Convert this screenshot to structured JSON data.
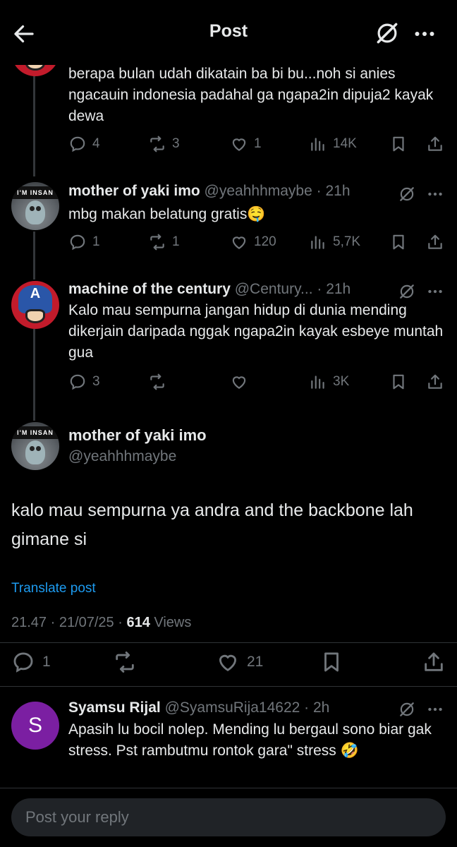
{
  "header": {
    "title": "Post"
  },
  "tweets": [
    {
      "body_partial": "berapa bulan udah dikatain ba bi bu...noh si anies ngacauin indonesia padahal ga ngapa2in dipuja2 kayak dewa",
      "replies": "4",
      "retweets": "3",
      "likes": "1",
      "views": "14K"
    },
    {
      "name": "mother of yaki imo",
      "handle": "@yeahhhmaybe",
      "time": "21h",
      "avatar_text": "I'M INSAN",
      "body": "mbg makan belatung gratis🤤",
      "replies": "1",
      "retweets": "1",
      "likes": "120",
      "views": "5,7K"
    },
    {
      "name": "machine of the century",
      "handle": "@Century...",
      "time": "21h",
      "avatar_text": "A",
      "body": "Kalo mau sempurna jangan hidup di dunia mending dikerjain daripada nggak ngapa2in kayak esbeye muntah gua",
      "replies": "3",
      "retweets": "",
      "likes": "",
      "views": "3K"
    }
  ],
  "focus": {
    "name": "mother of yaki imo",
    "handle": "@yeahhhmaybe",
    "avatar_text": "I'M INSAN",
    "text": "kalo mau sempurna ya andra and the backbone lah gimane si",
    "translate": "Translate post",
    "timestamp": "21.47 · 21/07/25 · ",
    "views_count": "614",
    "views_label": " Views",
    "replies": "1",
    "likes": "21"
  },
  "reply": {
    "name": "Syamsu Rijal",
    "handle": "@SyamsuRija14622",
    "time": "2h",
    "avatar_letter": "S",
    "body": "Apasih lu bocil nolep. Mending lu bergaul sono biar gak stress. Pst rambutmu rontok gara\" stress 🤣"
  },
  "composer": {
    "placeholder": "Post your reply"
  },
  "colors": {
    "accent": "#1d9bf0",
    "muted": "#71767b",
    "reply_avatar": "#7b1fa2"
  }
}
